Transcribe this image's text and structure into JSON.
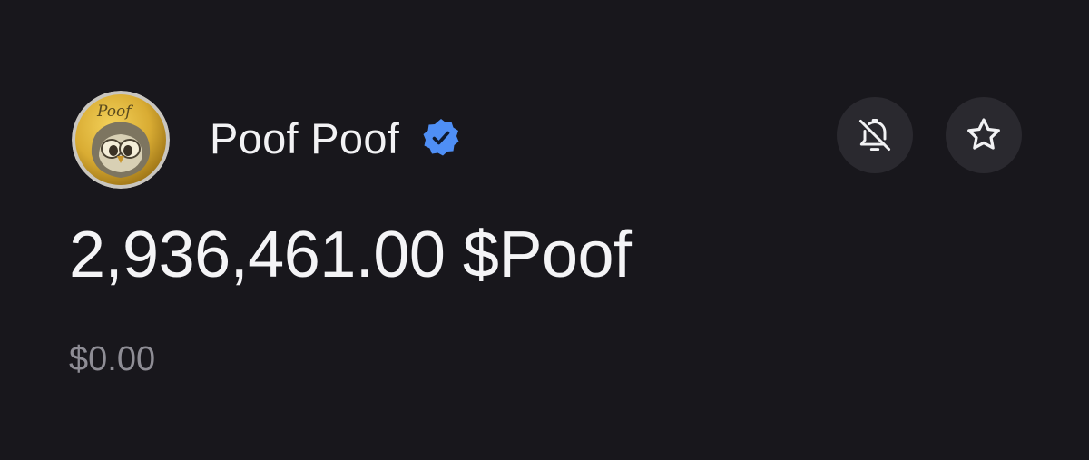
{
  "token": {
    "name": "Poof Poof",
    "avatar_text": "Poof",
    "verified": true
  },
  "balance": {
    "amount": "2,936,461.00 $Poof",
    "fiat_value": "$0.00"
  },
  "actions": {
    "notify_icon": "bell-off-icon",
    "favorite_icon": "star-icon"
  },
  "colors": {
    "background": "#18171c",
    "button_background": "#2a292f",
    "verified_badge": "#4f8ff5",
    "fiat_text": "#8e8d95"
  }
}
